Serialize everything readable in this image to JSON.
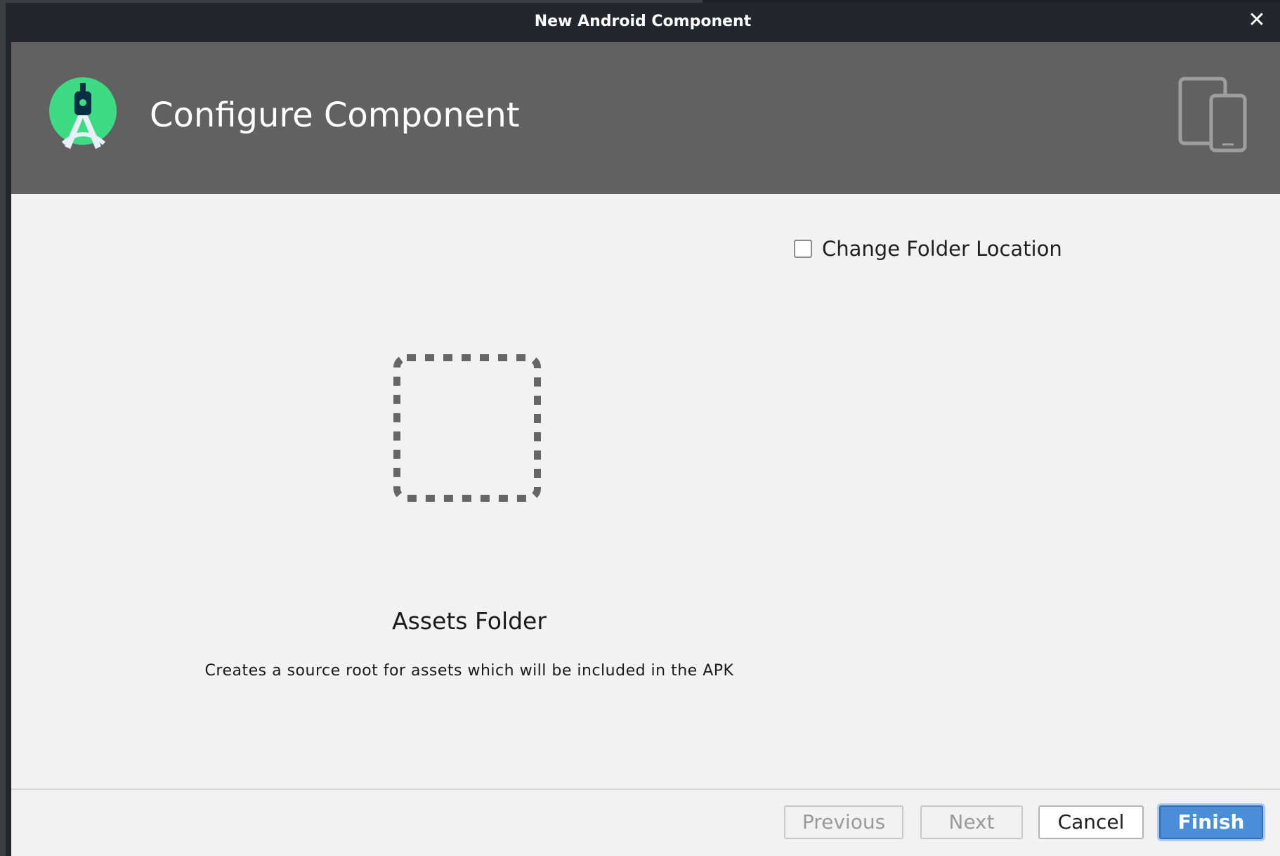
{
  "window": {
    "title": "New Android Component",
    "close_glyph": "✕"
  },
  "header": {
    "title": "Configure Component",
    "logo_icon": "android-studio-logo-icon",
    "devices_icon": "tablet-phone-icon"
  },
  "options": {
    "change_folder_location_label": "Change Folder Location",
    "change_folder_location_checked": false
  },
  "component": {
    "icon": "dashed-square-placeholder-icon",
    "title": "Assets Folder",
    "description": "Creates a source root for assets which will be included in the APK"
  },
  "footer": {
    "previous_label": "Previous",
    "next_label": "Next",
    "cancel_label": "Cancel",
    "finish_label": "Finish"
  },
  "colors": {
    "title_bar": "#24262d",
    "header_band": "#616161",
    "content_bg": "#f2f2f2",
    "primary_button": "#4a8ed8",
    "logo_green": "#3ddc84"
  }
}
